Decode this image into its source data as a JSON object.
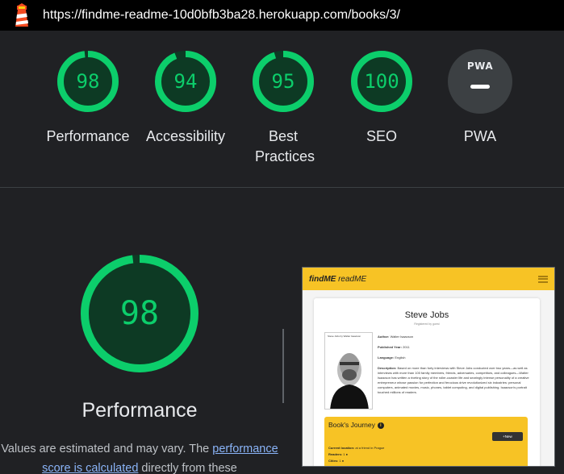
{
  "browser": {
    "url": "https://findme-readme-10d0bfb3ba28.herokuapp.com/books/3/",
    "logo_icon": "lighthouse-icon"
  },
  "categories": [
    {
      "label": "Performance",
      "score": "98",
      "score_value": 98
    },
    {
      "label": "Accessibility",
      "score": "94",
      "score_value": 94
    },
    {
      "label": "Best Practices",
      "score": "95",
      "score_value": 95
    },
    {
      "label": "SEO",
      "score": "100",
      "score_value": 100
    },
    {
      "label": "PWA",
      "badge_text": "PWA"
    }
  ],
  "detail": {
    "score": "98",
    "score_value": 98,
    "title": "Performance",
    "note_before": "Values are estimated and may vary. The ",
    "note_link": "performance score is calculated",
    "note_after": " directly from these"
  },
  "screenshot": {
    "brand_find": "findME",
    "brand_read": " readME",
    "book_title": "Steve Jobs",
    "registered": "Registered by guest",
    "cover_title": "Steve Jobs by Walter Isaacson",
    "author_label": "Author:",
    "author": "Walter Isaacson",
    "year_label": "Published Year:",
    "year": "2011",
    "language_label": "Language:",
    "language": "English",
    "description_label": "Description:",
    "description": "Based on more than forty interviews with Steve Jobs conducted over two years—as well as interviews with more than 100 family members, friends, adversaries, competitors, and colleagues—Walter Isaacson has written a riveting story of the roller-coaster life and searingly intense personality of a creative entrepreneur whose passion for perfection and ferocious drive revolutionized six industries: personal computers, animated movies, music, phones, tablet computing, and digital publishing. Isaacson's portrait touched millions of readers.",
    "journey_title": "Book's Journey",
    "new_button": "+New",
    "current_location_label": "Current location:",
    "current_location": "at a friend in Prague",
    "readers_label": "Readers:",
    "readers": "1",
    "cities_label": "Cities:",
    "cities": "1"
  },
  "colors": {
    "pass": "#0cce6b",
    "pass_bg": "#0d3a24",
    "background": "#202124",
    "brand_yellow": "#f7c325"
  }
}
